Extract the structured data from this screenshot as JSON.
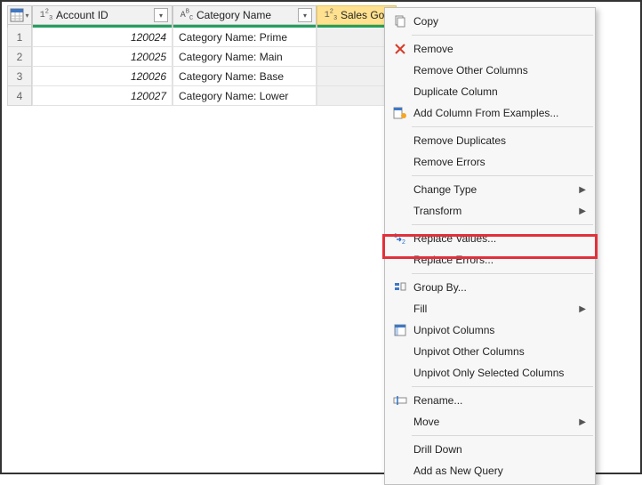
{
  "columns": {
    "account_id": {
      "label": "Account ID",
      "type_icon": "int"
    },
    "category_name": {
      "label": "Category Name",
      "type_icon": "text"
    },
    "sales_goal": {
      "label": "Sales Goal",
      "type_icon": "int"
    }
  },
  "rows": [
    {
      "n": "1",
      "account_id": "120024",
      "category_name": "Category Name: Prime"
    },
    {
      "n": "2",
      "account_id": "120025",
      "category_name": "Category Name: Main"
    },
    {
      "n": "3",
      "account_id": "120026",
      "category_name": "Category Name: Base"
    },
    {
      "n": "4",
      "account_id": "120027",
      "category_name": "Category Name: Lower"
    }
  ],
  "menu": {
    "copy": "Copy",
    "remove": "Remove",
    "remove_other": "Remove Other Columns",
    "duplicate": "Duplicate Column",
    "add_from_examples": "Add Column From Examples...",
    "remove_dups": "Remove Duplicates",
    "remove_errors": "Remove Errors",
    "change_type": "Change Type",
    "transform": "Transform",
    "replace_values": "Replace Values...",
    "replace_errors": "Replace Errors...",
    "group_by": "Group By...",
    "fill": "Fill",
    "unpivot": "Unpivot Columns",
    "unpivot_other": "Unpivot Other Columns",
    "unpivot_selected": "Unpivot Only Selected Columns",
    "rename": "Rename...",
    "move": "Move",
    "drill_down": "Drill Down",
    "add_query": "Add as New Query"
  }
}
